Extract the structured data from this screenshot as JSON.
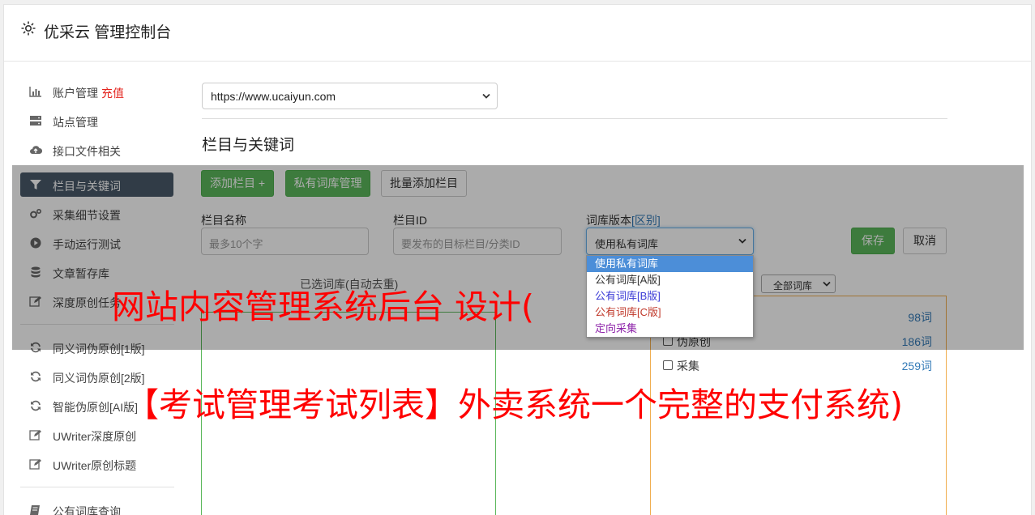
{
  "app": {
    "title": "优采云 管理控制台"
  },
  "sidebar": {
    "items": [
      {
        "label": "账户管理",
        "extra": "充值",
        "icon": "bar-chart-icon"
      },
      {
        "label": "站点管理",
        "icon": "server-icon"
      },
      {
        "label": "接口文件相关",
        "icon": "cloud-upload-icon"
      },
      {
        "label": "栏目与关键词",
        "icon": "filter-icon",
        "active": true
      },
      {
        "label": "采集细节设置",
        "icon": "gears-icon"
      },
      {
        "label": "手动运行测试",
        "icon": "play-circle-icon"
      },
      {
        "label": "文章暂存库",
        "icon": "database-icon"
      },
      {
        "label": "深度原创任务",
        "icon": "edit-icon"
      },
      {
        "label": "同义词伪原创[1版]",
        "icon": "refresh-icon"
      },
      {
        "label": "同义词伪原创[2版]",
        "icon": "refresh-icon"
      },
      {
        "label": "智能伪原创[AI版]",
        "icon": "refresh-icon"
      },
      {
        "label": "UWriter深度原创",
        "icon": "edit-icon"
      },
      {
        "label": "UWriter原创标题",
        "icon": "edit-icon"
      },
      {
        "label": "公有词库查询",
        "icon": "book-icon"
      }
    ]
  },
  "main": {
    "site_select": {
      "value": "https://www.ucaiyun.com"
    },
    "section_title": "栏目与关键词",
    "buttons": {
      "add_column": "添加栏目 +",
      "private_lexicon": "私有词库管理",
      "batch_add": "批量添加栏目",
      "save": "保存",
      "cancel": "取消"
    },
    "form": {
      "name_label": "栏目名称",
      "name_placeholder": "最多10个字",
      "id_label": "栏目ID",
      "id_placeholder": "要发布的目标栏目/分类ID",
      "version_label": "词库版本",
      "version_link": "[区别]",
      "version_value": "使用私有词库"
    },
    "dropdown_options": [
      {
        "label": "使用私有词库",
        "color": "#ffffff"
      },
      {
        "label": "公有词库[A版]",
        "color": "#333333"
      },
      {
        "label": "公有词库[B版]",
        "color": "#3b3bd6"
      },
      {
        "label": "公有词库[C版]",
        "color": "#c0392b"
      },
      {
        "label": "定向采集",
        "color": "#8e24aa"
      }
    ],
    "selected_caption": "已选词库(自动去重)",
    "lexicon_filter": "全部词库",
    "lexicon_rows": [
      {
        "label": "",
        "count": "98词"
      },
      {
        "label": "伪原创",
        "count": "186词"
      },
      {
        "label": "采集",
        "count": "259词"
      }
    ]
  },
  "watermark": {
    "line1": "网站内容管理系统后台 设计(",
    "line2": "【考试管理考试列表】外卖系统一个完整的支付系统)"
  }
}
